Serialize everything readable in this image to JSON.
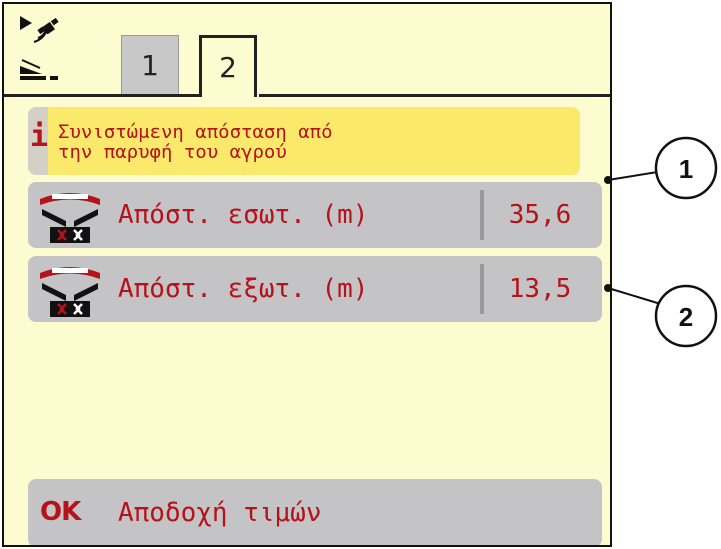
{
  "tabs": [
    {
      "label": "1",
      "active": false
    },
    {
      "label": "2",
      "active": true
    }
  ],
  "status_icons": [
    "gps-arrow-icon",
    "boundary-spread-icon"
  ],
  "info": {
    "icon": "i",
    "text": "Συνιστώμενη απόσταση από\nτην παρυφή του αγρού"
  },
  "rows": [
    {
      "label": "Απόστ. εσωτ. (m)",
      "value": "35,6",
      "icon": "spreader-inner-icon"
    },
    {
      "label": "Απόστ. εξωτ. (m)",
      "value": "13,5",
      "icon": "spreader-outer-icon"
    }
  ],
  "ok_button": {
    "icon_text": "OK",
    "label": "Αποδοχή τιμών"
  },
  "callouts": [
    "1",
    "2"
  ],
  "colors": {
    "screen_bg": "#fdfbd0",
    "info_bg": "#fbe96b",
    "row_bg": "#c4c4c6",
    "text_red": "#b5121b"
  }
}
